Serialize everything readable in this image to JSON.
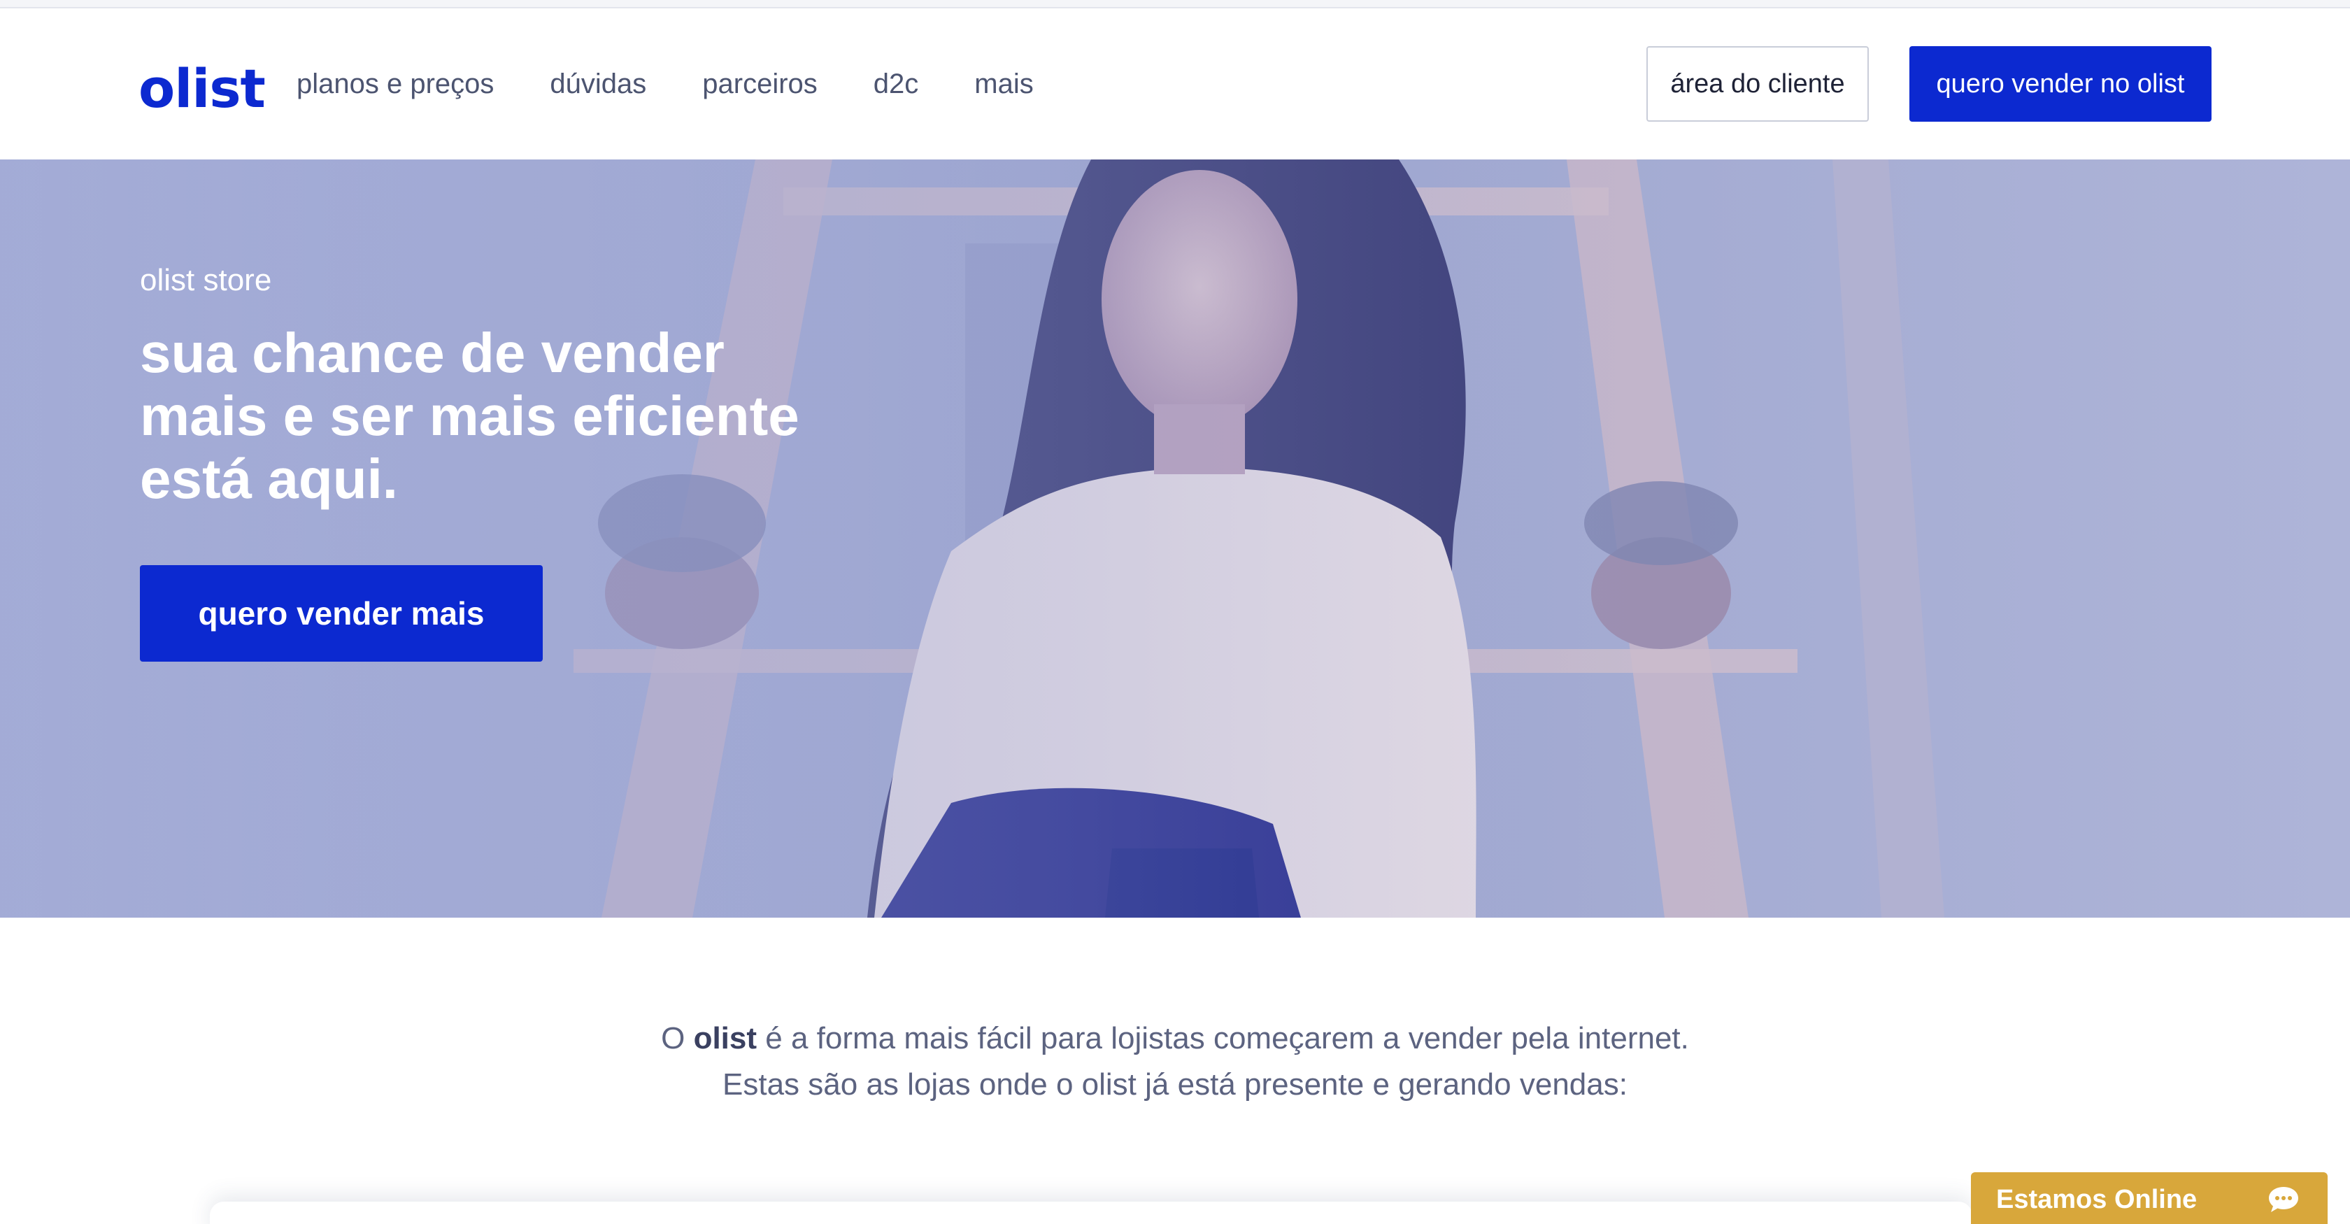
{
  "header": {
    "logo": "olist",
    "nav": [
      "planos e preços",
      "dúvidas",
      "parceiros",
      "d2c",
      "mais"
    ],
    "client_area_label": "área do cliente",
    "sell_label": "quero vender no olist"
  },
  "hero": {
    "kicker": "olist store",
    "title": "sua chance de vender mais e ser mais eficiente está aqui.",
    "cta_label": "quero vender mais"
  },
  "intro": {
    "line1_prefix": "O ",
    "line1_brand": "olist",
    "line1_suffix": " é a forma mais fácil para lojistas começarem a vender pela internet.",
    "line2": "Estas são as lojas onde o olist já está presente e gerando vendas:"
  },
  "chat": {
    "label": "Estamos Online",
    "icon": "chat-bubble-icon"
  },
  "colors": {
    "brand_blue": "#0c29d0",
    "hero_tint": "#aab1d5",
    "chat_bg": "#d8a73b",
    "nav_text": "#4c5470"
  }
}
